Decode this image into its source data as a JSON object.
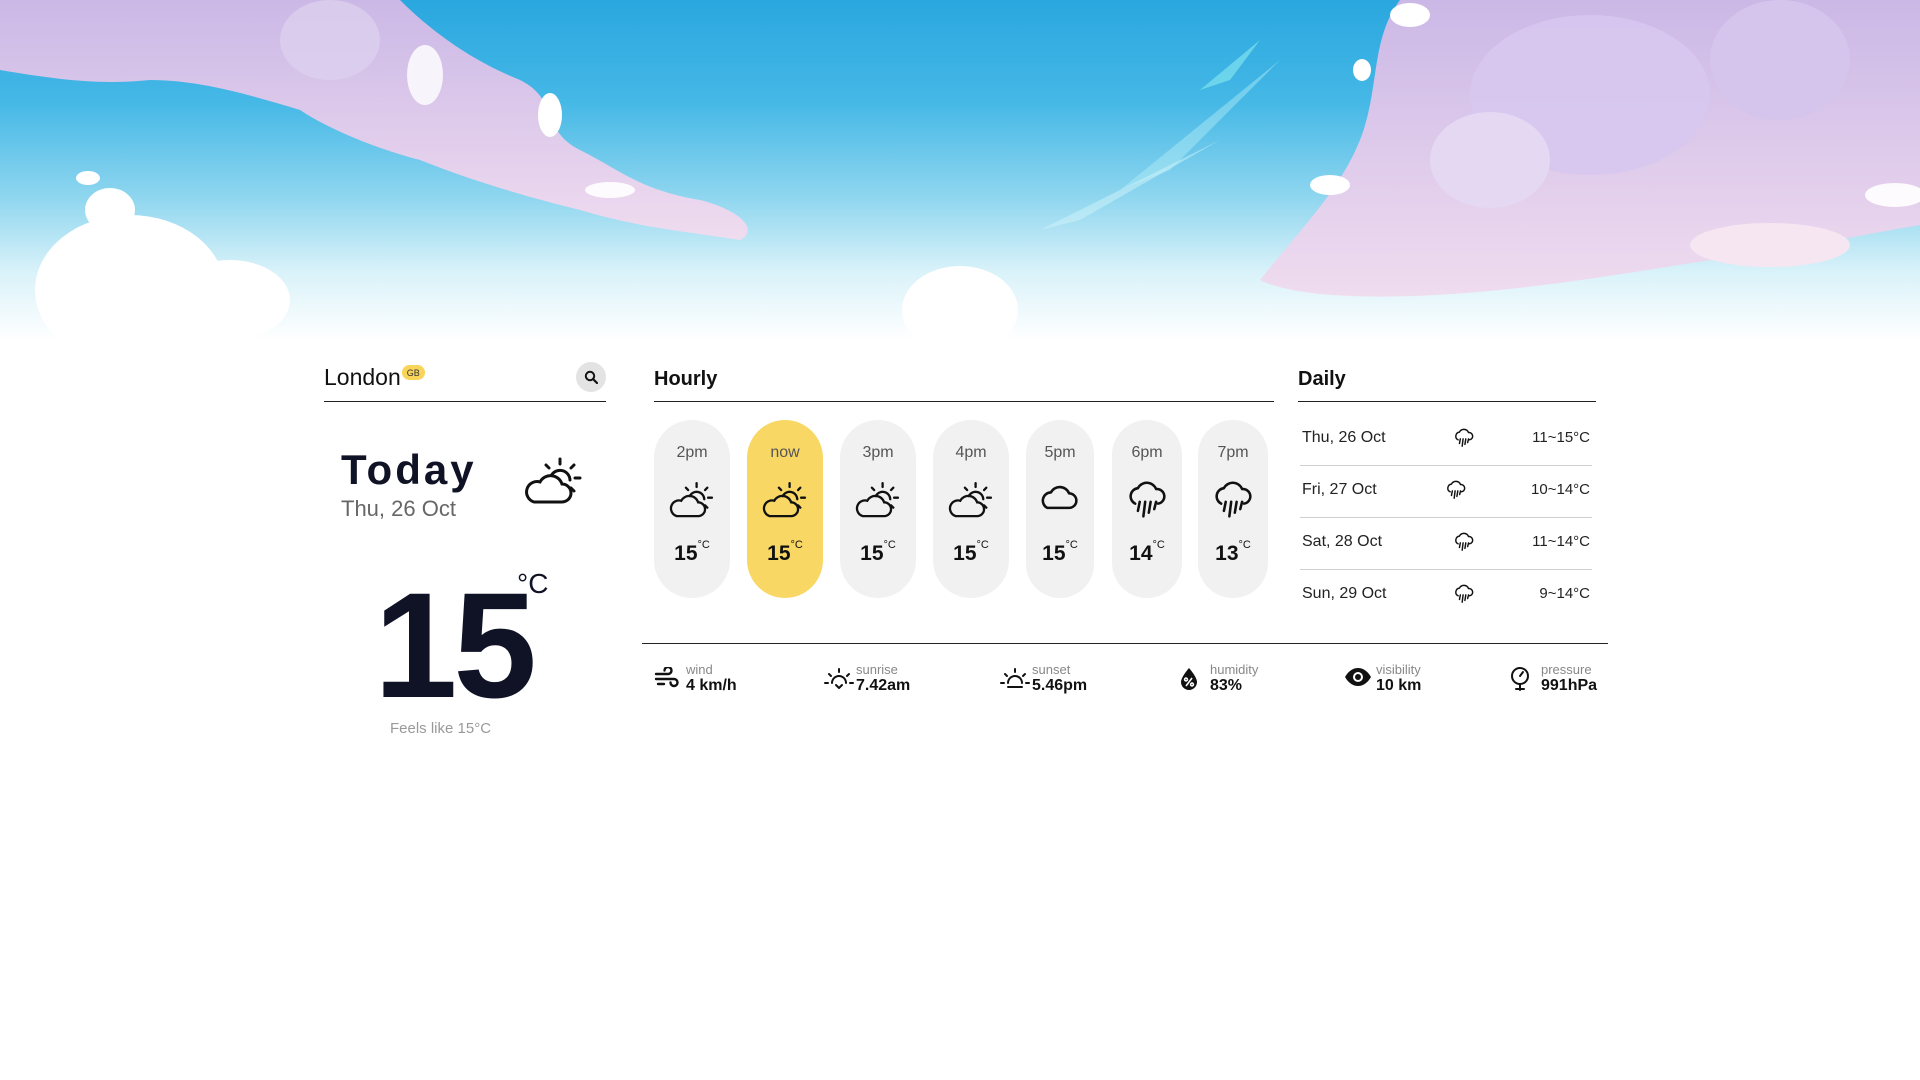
{
  "location": {
    "city": "London",
    "country_code": "GB",
    "search_icon": "search-icon"
  },
  "today": {
    "title": "Today",
    "date": "Thu, 26 Oct",
    "icon": "partly-sunny-icon",
    "temperature": "15",
    "unit": "°C",
    "feels_like": "Feels like 15°C"
  },
  "hourly": {
    "title": "Hourly",
    "items": [
      {
        "time": "2pm",
        "temp": "15",
        "unit": "°C",
        "icon": "partly-sunny-icon"
      },
      {
        "time": "now",
        "temp": "15",
        "unit": "°C",
        "icon": "partly-sunny-icon",
        "active": true
      },
      {
        "time": "3pm",
        "temp": "15",
        "unit": "°C",
        "icon": "partly-sunny-icon"
      },
      {
        "time": "4pm",
        "temp": "15",
        "unit": "°C",
        "icon": "partly-sunny-icon"
      },
      {
        "time": "5pm",
        "temp": "15",
        "unit": "°C",
        "icon": "cloud-icon"
      },
      {
        "time": "6pm",
        "temp": "14",
        "unit": "°C",
        "icon": "rain-icon"
      },
      {
        "time": "7pm",
        "temp": "13",
        "unit": "°C",
        "icon": "rain-icon"
      }
    ]
  },
  "daily": {
    "title": "Daily",
    "items": [
      {
        "day": "Thu, 26 Oct",
        "range": "11~15°C",
        "icon": "rain-icon"
      },
      {
        "day": "Fri, 27 Oct",
        "range": "10~14°C",
        "icon": "rain-icon"
      },
      {
        "day": "Sat, 28 Oct",
        "range": "11~14°C",
        "icon": "rain-icon"
      },
      {
        "day": "Sun, 29 Oct",
        "range": "9~14°C",
        "icon": "rain-icon"
      }
    ]
  },
  "stats": {
    "wind": {
      "label": "wind",
      "value": "4 km/h",
      "icon": "wind-icon"
    },
    "sunrise": {
      "label": "sunrise",
      "value": "7.42am",
      "icon": "sunrise-icon"
    },
    "sunset": {
      "label": "sunset",
      "value": "5.46pm",
      "icon": "sunset-icon"
    },
    "humidity": {
      "label": "humidity",
      "value": "83%",
      "icon": "humidity-icon"
    },
    "visibility": {
      "label": "visibility",
      "value": "10 km",
      "icon": "eye-icon"
    },
    "pressure": {
      "label": "pressure",
      "value": "991hPa",
      "icon": "pressure-icon"
    }
  },
  "colors": {
    "accent": "#f8d764",
    "card": "#f1f1f1",
    "sky_top": "#2aa7df",
    "cloud": "#d8c8ea"
  }
}
